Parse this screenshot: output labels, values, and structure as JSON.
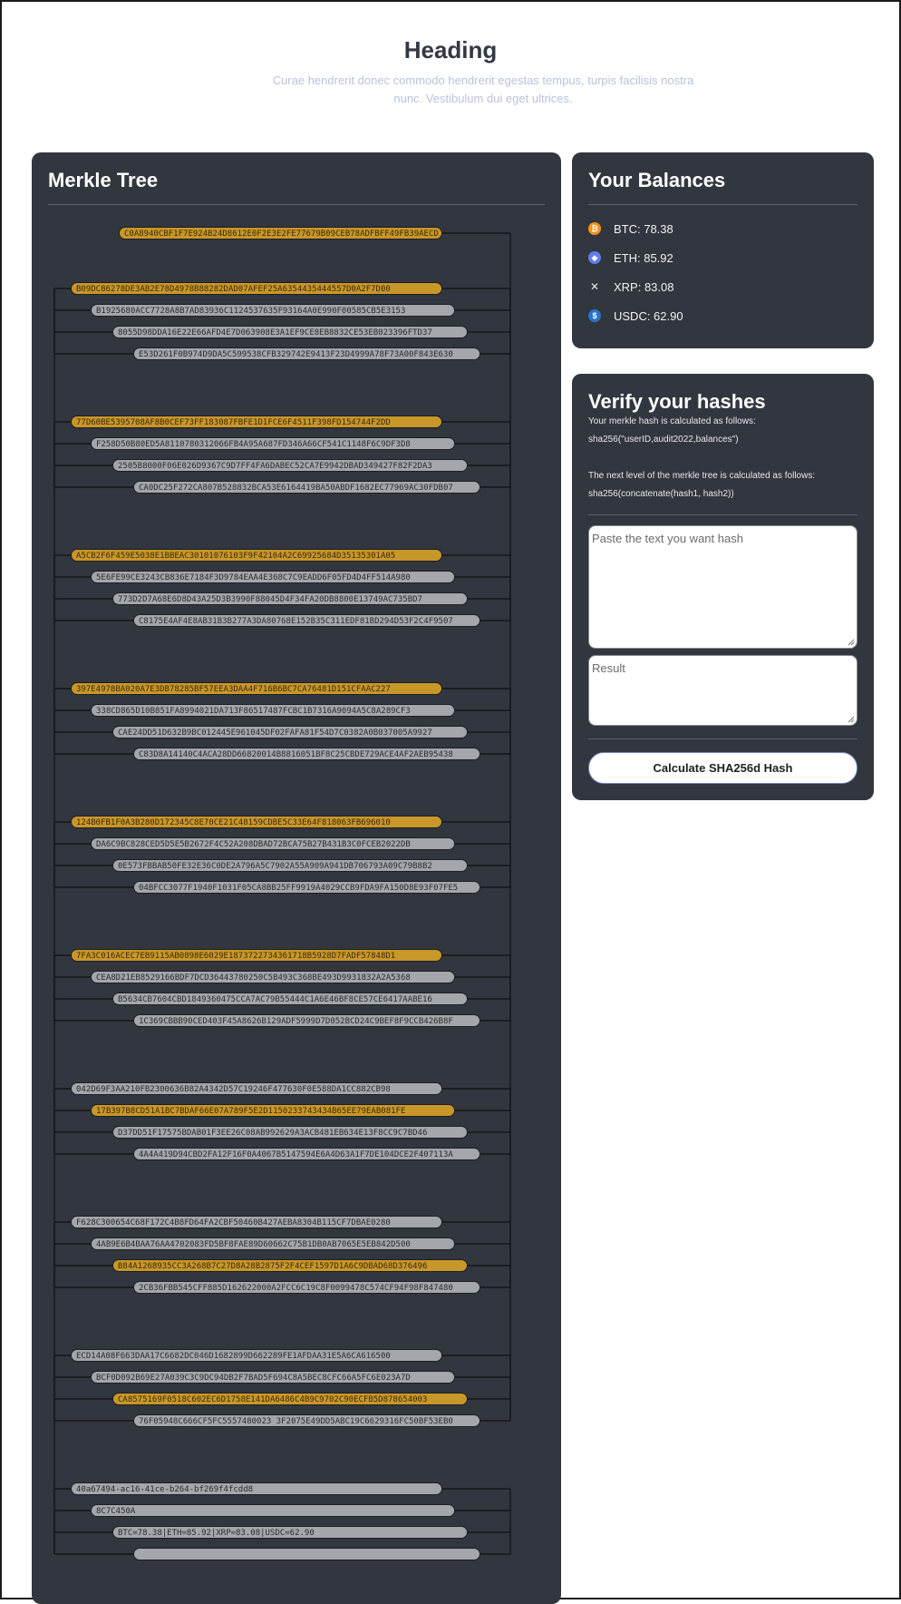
{
  "header": {
    "title": "Heading",
    "subtitle": "Curae hendrerit donec commodo hendrerit egestas tempus, turpis facilisis nostra nunc. Vestibulum dui eget ultrices."
  },
  "merkle": {
    "title": "Merkle Tree",
    "root": "C0A8940CBF1F7E924B24D8612E0F2E3E2FE77679B09CEB78ADFBFF49FB39AECD",
    "groups": [
      {
        "nodes": [
          {
            "text": "B09DC86278DE3AB2E78D4978B88282DAD07AFEF25A6354435444557D0A2F7D00",
            "level": 0,
            "hl": true
          },
          {
            "text": "B1925680ACC7728A8B7AD83936C1124537635F93164A0E990F00585CB5E3153",
            "level": 1,
            "hl": false
          },
          {
            "text": "8055D98DDA16E22E66AFD4E7D063908E3A1EF9CE8EB8832CE53EB023396FTD37",
            "level": 2,
            "hl": false
          },
          {
            "text": "E53D261F0B974D9DA5C599538CFB329742E9413F23D4999A78F73A00F843E630",
            "level": 3,
            "hl": false
          }
        ]
      },
      {
        "nodes": [
          {
            "text": "77D60BE5395708AF8B0CEF73FF183087FBFE1D1FCE6F4511F398FD154744F2DD",
            "level": 0,
            "hl": true
          },
          {
            "text": "F258D50B80ED5A8110780312066FB4A95A687FD346A66CF541C1148F6C9DF3D8",
            "level": 1,
            "hl": false
          },
          {
            "text": "2505B8000F06E026D9367C9D7FF4FA6DABEC52CA7E9942DBAD349427F82F2DA3",
            "level": 2,
            "hl": false
          },
          {
            "text": "CA0DC25F272CA807B528832BCA53E6164419BA50ABDF1682EC77969AC30FDB07",
            "level": 3,
            "hl": false
          }
        ]
      },
      {
        "nodes": [
          {
            "text": "A5CB2F6F459E5038E1BBEAC30101076103F9F42104A2C69925684D35135301A05",
            "level": 0,
            "hl": true
          },
          {
            "text": "5E6FE99CE3243CB836E7184F3D9784EAA4E368C7C9EADD6F05FD4D4FF514A980",
            "level": 1,
            "hl": false
          },
          {
            "text": "773D2D7A68E6D8D43A25D3B3990F88045D4F34FA20DB8800E13749AC735BD7",
            "level": 2,
            "hl": false
          },
          {
            "text": "C8175E4AF4E8AB31B3B277A3DA80768E152B35C311EDF81BD294D53F2C4F9507",
            "level": 3,
            "hl": false
          }
        ]
      },
      {
        "nodes": [
          {
            "text": "397E4978BA020A7E3DB78285BF57EEA3DAA4F716B6BC7CA76481D151CFAAC227",
            "level": 0,
            "hl": true
          },
          {
            "text": "338CD865D10B851FA8994021DA713F86517487FCBC1B7316A9094A5C8A289CF3",
            "level": 1,
            "hl": false
          },
          {
            "text": "CAE24DD51D632B9BC012445E961045DF02FAFA81F54D7C0382A0B037005A9927",
            "level": 2,
            "hl": false
          },
          {
            "text": "C83D8A14140C4ACA28DD66820014B8816051BF8C25CBDE729ACE4AF2AEB95438",
            "level": 3,
            "hl": false
          }
        ]
      },
      {
        "nodes": [
          {
            "text": "124B0FB1F0A3B280D172345C8E70CE21C48159CDBE5C33E64F818063FB696010",
            "level": 0,
            "hl": true
          },
          {
            "text": "DA6C9BC828CED5D5E5B2672F4C52A208DBAD72BCA75B27B431B3C0FCEB2022DB",
            "level": 1,
            "hl": false
          },
          {
            "text": "0E573FBBAB50FE32E36C0DE2A796A5C7902A55A909A941DB706793A09C79B8B2",
            "level": 2,
            "hl": false
          },
          {
            "text": "04BFCC3077F1940F1031F05CA8BB25FF9919A4029CCB9FDA9FA150D8E93F07FE5",
            "level": 3,
            "hl": false
          }
        ]
      },
      {
        "nodes": [
          {
            "text": "7FA3C016ACEC7EB9115AB0898E6029E1873722734361718B5928D7FADF57848D1",
            "level": 0,
            "hl": true
          },
          {
            "text": "CEA8D21EB8529166BDF7DCD36443780250C5B493C368BE493D9931832A2A5368",
            "level": 1,
            "hl": false
          },
          {
            "text": "B5634CB7604CBD1849360475CCA7AC79B55444C1A6E46BF8CE57CE6417AABE16",
            "level": 2,
            "hl": false
          },
          {
            "text": "1C369CBBB90CED403F45A8626B129ADF5999D7D052BCD24C9BEF8F9CCB426B8F",
            "level": 3,
            "hl": false
          }
        ]
      },
      {
        "nodes": [
          {
            "text": "042D69F3AA210FB2300636B82A4342D57C19246F477630F0E588DA1CC882CB98",
            "level": 0,
            "hl": false
          },
          {
            "text": "17B397B8CD51A1BC7BDAF66E07A789F5E2D1150233743434B65EE79EAB081FE",
            "level": 1,
            "hl": true
          },
          {
            "text": "D37DD51F17575BDAB01F3EE26C08AB992629A3ACB481EB634E13F8CC9C7BD46",
            "level": 2,
            "hl": false
          },
          {
            "text": "4A4A419D94CBD2FA12F16F0A4067B5147594E6A4D63A1F7DE104DCE2F407113A",
            "level": 3,
            "hl": false
          }
        ]
      },
      {
        "nodes": [
          {
            "text": "F628C300654C68F172C4B8FD64FA2CBF50460B427AEBA8304B115CF7DBAE0280",
            "level": 0,
            "hl": false
          },
          {
            "text": "4AB9E6B4BAA76AA4702083FD5BF8FAE89D60662C75B1DB0AB7065E5EB842D500",
            "level": 1,
            "hl": false
          },
          {
            "text": "B84A1268935CC3A268B7C27D8A28B2875F2F4CEF1597D1A6C9DBAD68D376496",
            "level": 2,
            "hl": true
          },
          {
            "text": "2CB36FBB545CFF885D162622000A2FCC6C19C8F0099478C574CF94F98F847480",
            "level": 3,
            "hl": false
          }
        ]
      },
      {
        "nodes": [
          {
            "text": "ECD14A08F663DAA17C6682DC046D1682899D662289FE1AFDAA31E5A6CA616500",
            "level": 0,
            "hl": false
          },
          {
            "text": "BCF0D092B69E27A039C3C9DC94DB2F7BAD5F694C8A5BEC8CFC66A5FC6E023A7D",
            "level": 1,
            "hl": false
          },
          {
            "text": "CA8575169F0518C602EC6D1758E141DA6486C4B9C9702C90ECFB5D878654003",
            "level": 2,
            "hl": true
          },
          {
            "text": "76F05948C666CF5FC5557480023 3F2075E49DD5ABC19C6629316FC50BF53EB0",
            "level": 3,
            "hl": false
          }
        ]
      },
      {
        "nodes": [
          {
            "text": "40a67494-ac16-41ce-b264-bf269f4fcdd8",
            "level": 0,
            "hl": false
          },
          {
            "text": "8C7C450A",
            "level": 1,
            "hl": false
          },
          {
            "text": "BTC=78.38|ETH=85.92|XRP=83.08|USDC=62.90",
            "level": 2,
            "hl": false
          },
          {
            "text": "",
            "level": 3,
            "hl": false
          }
        ]
      }
    ]
  },
  "balances": {
    "title": "Your Balances",
    "items": [
      {
        "label": "BTC: 78.38",
        "icon": "bitcoin-icon",
        "glyph": "₿",
        "color": "#f7931a"
      },
      {
        "label": "ETH: 85.92",
        "icon": "ethereum-icon",
        "glyph": "◆",
        "color": "#627eea"
      },
      {
        "label": "XRP: 83.08",
        "icon": "xrp-icon",
        "glyph": "✕",
        "color": "#23292f"
      },
      {
        "label": "USDC: 62.90",
        "icon": "usdc-icon",
        "glyph": "$",
        "color": "#2775ca"
      }
    ]
  },
  "verify": {
    "title": "Verify your hashes",
    "line1": "Your merkle hash is calculated as follows:",
    "line2": "sha256(\"userID,audit2022,balances\")",
    "line3": "The next level of the merkle tree is calculated as follows:",
    "line4": "sha256(concatenate(hash1, hash2))",
    "input_placeholder": "Paste the text you want hash",
    "result_placeholder": "Result",
    "button_label": "Calculate SHA256d Hash"
  },
  "colors": {
    "panel": "#32363e",
    "highlight": "#c8972a",
    "node": "#a3a6ab"
  }
}
